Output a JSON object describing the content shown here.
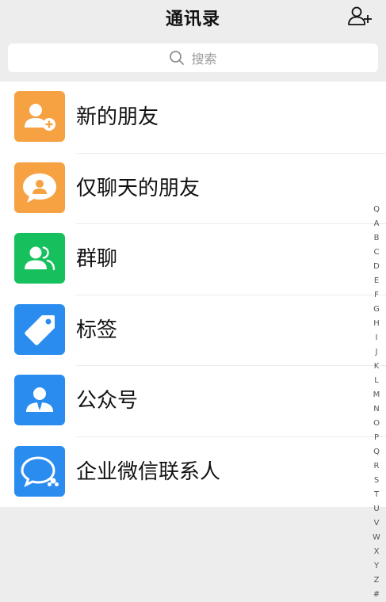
{
  "header": {
    "title": "通讯录"
  },
  "search": {
    "placeholder": "搜索"
  },
  "items": [
    {
      "label": "新的朋友",
      "color": "#f6a243",
      "icon": "add-friend-icon"
    },
    {
      "label": "仅聊天的朋友",
      "color": "#f6a243",
      "icon": "chat-only-friend-icon"
    },
    {
      "label": "群聊",
      "color": "#16c15d",
      "icon": "group-chat-icon"
    },
    {
      "label": "标签",
      "color": "#2b8cf0",
      "icon": "tag-icon"
    },
    {
      "label": "公众号",
      "color": "#2b8cf0",
      "icon": "official-account-icon"
    },
    {
      "label": "企业微信联系人",
      "color": "#2b8cf0",
      "icon": "work-wechat-contacts-icon"
    }
  ],
  "index_bar": [
    "Q",
    "A",
    "B",
    "C",
    "D",
    "E",
    "F",
    "G",
    "H",
    "I",
    "J",
    "K",
    "L",
    "M",
    "N",
    "O",
    "P",
    "Q",
    "R",
    "S",
    "T",
    "U",
    "V",
    "W",
    "X",
    "Y",
    "Z",
    "#"
  ]
}
